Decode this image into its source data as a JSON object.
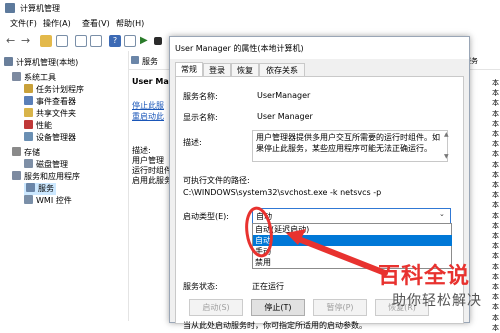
{
  "window": {
    "title": "计算机管理"
  },
  "menu": [
    "文件(F)",
    "操作(A)",
    "查看(V)",
    "帮助(H)"
  ],
  "tree": [
    {
      "label": "计算机管理(本地)",
      "level": 0,
      "color": "#6a7f9b"
    },
    {
      "label": "系统工具",
      "level": 1,
      "color": "#7d8aa0"
    },
    {
      "label": "任务计划程序",
      "level": 2,
      "color": "#c9a13a"
    },
    {
      "label": "事件查看器",
      "level": 2,
      "color": "#5a7fb8"
    },
    {
      "label": "共享文件夹",
      "level": 2,
      "color": "#d8b44a"
    },
    {
      "label": "性能",
      "level": 2,
      "color": "#c03838"
    },
    {
      "label": "设备管理器",
      "level": 2,
      "color": "#6a8fb3"
    },
    {
      "label": "存储",
      "level": 1,
      "color": "#8a8a8a"
    },
    {
      "label": "磁盘管理",
      "level": 2,
      "color": "#7e8fa6"
    },
    {
      "label": "服务和应用程序",
      "level": 1,
      "color": "#7d8aa0"
    },
    {
      "label": "服务",
      "level": 2,
      "color": "#6b86a8",
      "selected": true
    },
    {
      "label": "WMI 控件",
      "level": 2,
      "color": "#7a8fa8"
    }
  ],
  "middle": {
    "header": "服务",
    "service_name": "User Man",
    "links": [
      "停止此服",
      "重启动此"
    ],
    "desc_label": "描述:",
    "desc_lines": [
      "用户管理",
      "运行时组件",
      "启用此服务"
    ]
  },
  "right_header": "服务",
  "right_items": [
    "本",
    "本",
    "本",
    "本",
    "本",
    "本",
    "本",
    "本",
    "本",
    "本",
    "本",
    "本",
    "本",
    "本",
    "本",
    "本",
    "本",
    "本",
    "本",
    "本",
    "本",
    "本",
    "本",
    "本",
    "本"
  ],
  "dialog": {
    "title": "User Manager 的属性(本地计算机)",
    "tabs": [
      "常规",
      "登录",
      "恢复",
      "依存关系"
    ],
    "service_name_label": "服务名称:",
    "service_name": "UserManager",
    "display_name_label": "显示名称:",
    "display_name": "User Manager",
    "description_label": "描述:",
    "description": "用户管理器提供多用户交互所需要的运行时组件。如果停止此服务，某些应用程序可能无法正确运行。",
    "path_label": "可执行文件的路径:",
    "path": "C:\\WINDOWS\\system32\\svchost.exe -k netsvcs -p",
    "startup_label": "启动类型(E):",
    "startup_value": "自动",
    "startup_options": [
      "自动(延迟启动)",
      "自动",
      "手动",
      "禁用"
    ],
    "highlighted_option": "自动",
    "status_label": "服务状态:",
    "status_value": "正在运行",
    "buttons": {
      "start": "启动(S)",
      "stop": "停止(T)",
      "pause": "暂停(P)",
      "resume": "恢复(R)"
    },
    "footer_text": "当从此处启动服务时，你可指定所适用的启动参数。"
  },
  "watermark": {
    "title": "百科全说",
    "subtitle": "助你轻松解决"
  },
  "colors": {
    "annotation": "#e8322f",
    "highlight": "#0078d7",
    "selection": "#cce8ff"
  }
}
